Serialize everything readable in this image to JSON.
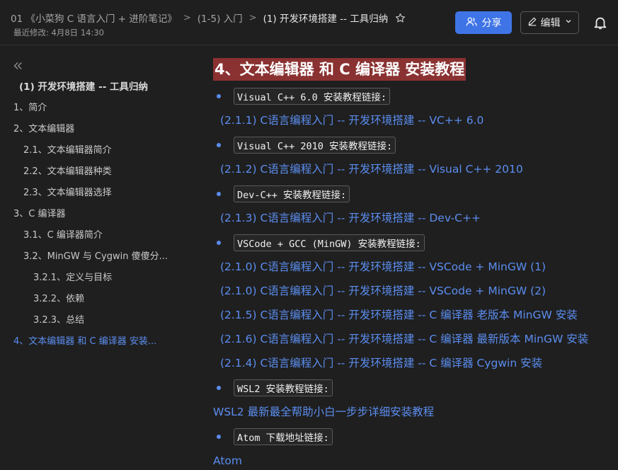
{
  "header": {
    "breadcrumb": [
      "01 《小菜狗 C 语言入门 + 进阶笔记》",
      "(1-5) 入门",
      "(1) 开发环境搭建 -- 工具归纳"
    ],
    "separator": ">",
    "last_modified": "最近修改: 4月8日 14:30",
    "share_label": "分享",
    "edit_label": "编辑"
  },
  "toc": {
    "title": "(1) 开发环境搭建 -- 工具归纳",
    "items": [
      "1、简介",
      "2、文本编辑器",
      "2.1、文本编辑器简介",
      "2.2、文本编辑器种类",
      "2.3、文本编辑器选择",
      "3、C 编译器",
      "3.1、C 编译器简介",
      "3.2、MinGW 与 Cygwin 傻傻分...",
      "3.2.1、定义与目标",
      "3.2.2、依赖",
      "3.2.3、总结",
      "4、文本编辑器 和 C 编译器 安装..."
    ]
  },
  "content": {
    "heading": "4、文本编辑器 和 C 编译器 安装教程",
    "bullets": [
      "Visual C++ 6.0 安装教程链接:",
      "Visual C++ 2010 安装教程链接:",
      "Dev-C++ 安装教程链接:",
      "VSCode + GCC (MinGW) 安装教程链接:",
      "WSL2 安装教程链接:",
      "Atom 下载地址链接:"
    ],
    "links": [
      "(2.1.1) C语言编程入门 -- 开发环境搭建 -- VC++ 6.0",
      "(2.1.2) C语言编程入门 -- 开发环境搭建 -- Visual C++ 2010",
      "(2.1.3) C语言编程入门 -- 开发环境搭建 -- Dev-C++",
      "(2.1.0) C语言编程入门 -- 开发环境搭建 -- VSCode + MinGW (1)",
      "(2.1.0) C语言编程入门 -- 开发环境搭建 -- VSCode + MinGW (2)",
      "(2.1.5) C语言编程入门 -- 开发环境搭建 -- C 编译器 老版本 MinGW 安装",
      "(2.1.6) C语言编程入门 -- 开发环境搭建 -- C 编译器 最新版本 MinGW 安装",
      "(2.1.4) C语言编程入门 -- 开发环境搭建 -- C 编译器 Cygwin 安装",
      "WSL2 最新最全帮助小白一步步详细安装教程",
      "Atom"
    ]
  },
  "colors": {
    "background": "#1f1f1f",
    "accent": "#3f74e6",
    "link": "#5b8def",
    "heading_highlight": "#8a3131"
  },
  "icons": [
    "star-icon",
    "user-group-icon",
    "pencil-icon",
    "chevron-down-icon",
    "bell-icon",
    "collapse-icon"
  ]
}
